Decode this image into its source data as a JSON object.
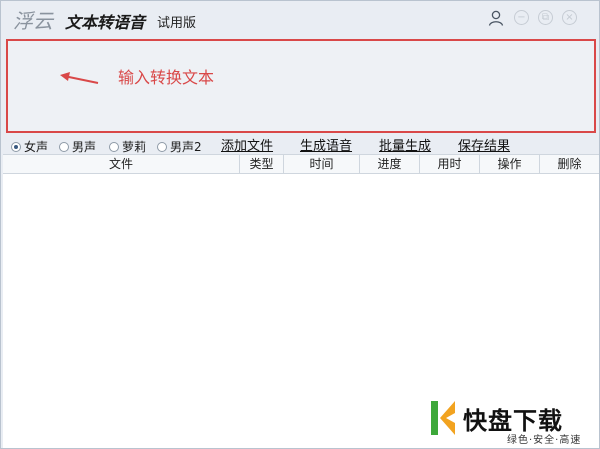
{
  "app": {
    "name": "浮云",
    "subtitle": "文本转语音",
    "edition": "试用版"
  },
  "window_controls": {
    "minimize_glyph": "−",
    "restore_glyph": "⧉",
    "close_glyph": "×"
  },
  "text_area": {
    "hint": "输入转换文本",
    "value": ""
  },
  "voices": [
    {
      "label": "女声",
      "selected": true
    },
    {
      "label": "男声",
      "selected": false
    },
    {
      "label": "萝莉",
      "selected": false
    },
    {
      "label": "男声2",
      "selected": false
    }
  ],
  "actions": {
    "add_file": "添加文件",
    "generate": "生成语音",
    "batch": "批量生成",
    "save": "保存结果"
  },
  "table": {
    "columns": [
      "文件",
      "类型",
      "时间",
      "进度",
      "用时",
      "操作",
      "删除"
    ],
    "rows": []
  },
  "watermark": {
    "brand": "快盘下载",
    "slogan": "绿色·安全·高速"
  },
  "colors": {
    "accent_red": "#d94848",
    "watermark_green": "#3da83a",
    "watermark_orange": "#f2a320"
  }
}
